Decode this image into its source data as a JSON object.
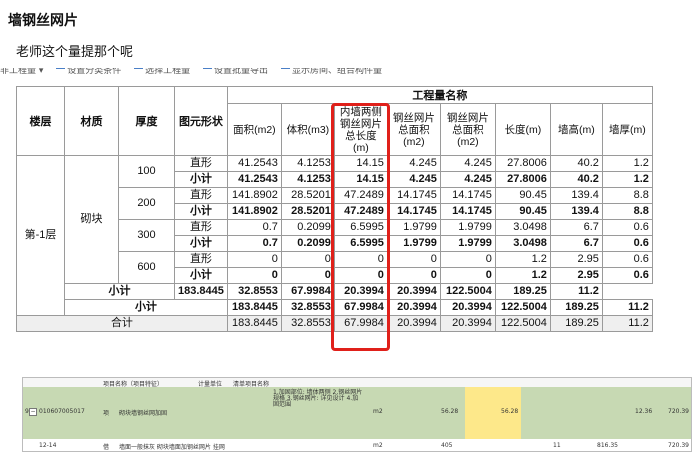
{
  "post": {
    "title": "墙钢丝网片",
    "question": "老师这个量提那个呢"
  },
  "toolbar_cut": [
    "非工程量 ▾",
    "设置分类条件",
    "选择工程量",
    "设置批量导出",
    "显示房间、组合构件量"
  ],
  "table": {
    "headers": {
      "floor": "楼层",
      "material": "材质",
      "thickness": "厚度",
      "shape": "图元形状",
      "group": "工程量名称",
      "area": "面积(m2)",
      "volume": "体积(m3)",
      "inner_mesh": "内墙两侧钢丝网片总长度(m)",
      "mesh_area": "钢丝网片总面积(m2)",
      "length": "长度(m)",
      "height": "墙高(m)",
      "wall_thickness": "墙厚(m)"
    },
    "floor_value": "第-1层",
    "material_value": "砌块",
    "groups": [
      {
        "thickness": "100",
        "rows": [
          {
            "shape": "直形",
            "v": [
              "41.2543",
              "4.1253",
              "14.15",
              "4.245",
              "4.245",
              "27.8006",
              "40.2",
              "1.2"
            ]
          },
          {
            "shape": "小计",
            "v": [
              "41.2543",
              "4.1253",
              "14.15",
              "4.245",
              "4.245",
              "27.8006",
              "40.2",
              "1.2"
            ]
          }
        ]
      },
      {
        "thickness": "200",
        "rows": [
          {
            "shape": "直形",
            "v": [
              "141.8902",
              "28.5201",
              "47.2489",
              "14.1745",
              "14.1745",
              "90.45",
              "139.4",
              "8.8"
            ]
          },
          {
            "shape": "小计",
            "v": [
              "141.8902",
              "28.5201",
              "47.2489",
              "14.1745",
              "14.1745",
              "90.45",
              "139.4",
              "8.8"
            ]
          }
        ]
      },
      {
        "thickness": "300",
        "rows": [
          {
            "shape": "直形",
            "v": [
              "0.7",
              "0.2099",
              "6.5995",
              "1.9799",
              "1.9799",
              "3.0498",
              "6.7",
              "0.6"
            ]
          },
          {
            "shape": "小计",
            "v": [
              "0.7",
              "0.2099",
              "6.5995",
              "1.9799",
              "1.9799",
              "3.0498",
              "6.7",
              "0.6"
            ]
          }
        ]
      },
      {
        "thickness": "600",
        "rows": [
          {
            "shape": "直形",
            "v": [
              "0",
              "0",
              "0",
              "0",
              "0",
              "1.2",
              "2.95",
              "0.6"
            ]
          },
          {
            "shape": "小计",
            "v": [
              "0",
              "0",
              "0",
              "0",
              "0",
              "1.2",
              "2.95",
              "0.6"
            ]
          }
        ]
      }
    ],
    "material_subtotal": {
      "label": "小计",
      "v": [
        "183.8445",
        "32.8553",
        "67.9984",
        "20.3994",
        "20.3994",
        "122.5004",
        "189.25",
        "11.2"
      ]
    },
    "floor_subtotal": {
      "label": "小计",
      "v": [
        "183.8445",
        "32.8553",
        "67.9984",
        "20.3994",
        "20.3994",
        "122.5004",
        "189.25",
        "11.2"
      ]
    },
    "total": {
      "label": "合计",
      "v": [
        "183.8445",
        "32.8553",
        "67.9984",
        "20.3994",
        "20.3994",
        "122.5004",
        "189.25",
        "11.2"
      ]
    },
    "highlight_color": "#e0201a"
  },
  "sheet": {
    "header_cells": [
      "项目名称（项目特征）",
      "计量单位",
      "清单项目名称"
    ],
    "row_index": "9",
    "code": "010607005017",
    "unit_label": "项",
    "name": "砌块墙钢丝网加固",
    "description": "1.加固部位: 墙体两侧 2.钢丝网片规格 3.钢丝网片: 详见设计 4.加固范围",
    "unit": "m2",
    "qty_a": "56.28",
    "qty_b": "56.28",
    "val_c": "12.36",
    "val_d": "720.39",
    "row2_index": "12-14",
    "row2_unit_label": "借",
    "row2_name": "墙面一般抹灰 砌块墙面加钢丝网片 挂网",
    "row2_unit": "m2",
    "row2_qty": "405",
    "row2_col5": "11",
    "row2_val_c": "816.35",
    "row2_val_d": "720.39"
  }
}
